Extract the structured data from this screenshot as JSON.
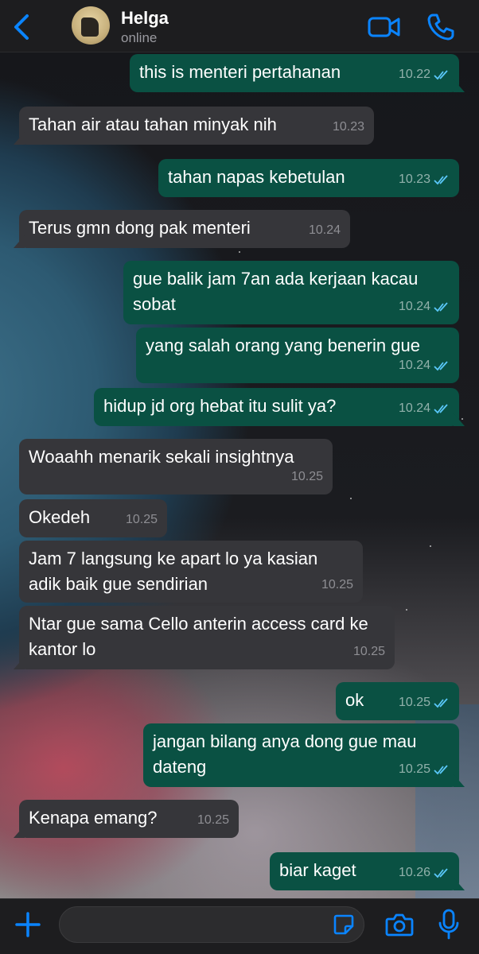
{
  "header": {
    "contact_name": "Helga",
    "status": "online"
  },
  "composer": {
    "placeholder": ""
  },
  "theme": {
    "accent": "#0a84ff",
    "outgoing_bubble": "#0a5143",
    "incoming_bubble": "#36363a",
    "read_ticks": "#5ac8fa"
  },
  "messages": [
    {
      "dir": "out",
      "text": "this is menteri pertahanan",
      "time": "10.22"
    },
    {
      "dir": "in",
      "text": "Tahan air atau tahan minyak nih",
      "time": "10.23"
    },
    {
      "dir": "out",
      "text": "tahan napas kebetulan",
      "time": "10.23"
    },
    {
      "dir": "in",
      "text": "Terus gmn dong pak menteri",
      "time": "10.24"
    },
    {
      "dir": "out",
      "text": "gue balik jam 7an ada kerjaan kacau sobat",
      "time": "10.24"
    },
    {
      "dir": "out",
      "text": "yang salah orang yang benerin gue",
      "time": "10.24"
    },
    {
      "dir": "out",
      "text": "hidup jd org hebat itu sulit ya?",
      "time": "10.24"
    },
    {
      "dir": "in",
      "text": "Woaahh menarik sekali insightnya",
      "time": "10.25"
    },
    {
      "dir": "in",
      "text": "Okedeh",
      "time": "10.25"
    },
    {
      "dir": "in",
      "text": "Jam 7 langsung ke apart lo ya kasian adik baik gue sendirian",
      "time": "10.25"
    },
    {
      "dir": "in",
      "text": "Ntar gue sama Cello anterin access card ke kantor lo",
      "time": "10.25"
    },
    {
      "dir": "out",
      "text": "ok",
      "time": "10.25"
    },
    {
      "dir": "out",
      "text": "jangan bilang anya dong gue mau dateng",
      "time": "10.25"
    },
    {
      "dir": "in",
      "text": "Kenapa emang?",
      "time": "10.25"
    },
    {
      "dir": "out",
      "text": "biar kaget",
      "time": "10.26"
    }
  ]
}
